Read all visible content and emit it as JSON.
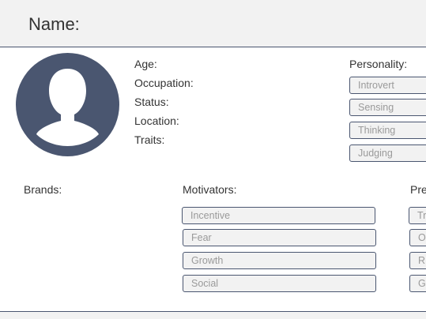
{
  "header": {
    "name_label": "Name:"
  },
  "profile": {
    "fields": {
      "age": "Age:",
      "occupation": "Occupation:",
      "status": "Status:",
      "location": "Location:",
      "traits": "Traits:"
    },
    "avatar_icon": "user-silhouette-icon"
  },
  "personality": {
    "label": "Personality:",
    "items": [
      "Introvert",
      "Sensing",
      "Thinking",
      "Judging"
    ]
  },
  "brands": {
    "label": "Brands:"
  },
  "motivators": {
    "label": "Motivators:",
    "items": [
      "Incentive",
      "Fear",
      "Growth",
      "Social"
    ]
  },
  "preferred": {
    "label": "Pre",
    "items": [
      "Tr",
      "O",
      "R",
      "G"
    ]
  },
  "colors": {
    "accent": "#4a5670",
    "header_bg": "#f2f2f2",
    "pill_text": "#9a9a9a"
  }
}
